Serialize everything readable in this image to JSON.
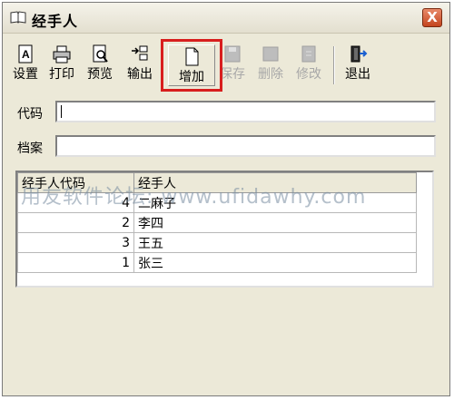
{
  "window": {
    "title": "经手人",
    "close_label": "X"
  },
  "toolbar": {
    "buttons": [
      {
        "label": "设置",
        "icon": "page-setup-icon",
        "enabled": true
      },
      {
        "label": "打印",
        "icon": "printer-icon",
        "enabled": true
      },
      {
        "label": "预览",
        "icon": "preview-icon",
        "enabled": true
      },
      {
        "label": "输出",
        "icon": "export-icon",
        "enabled": true
      },
      {
        "label": "增加",
        "icon": "new-document-icon",
        "enabled": true
      },
      {
        "label": "保存",
        "icon": "save-icon",
        "enabled": false
      },
      {
        "label": "删除",
        "icon": "delete-icon",
        "enabled": false
      },
      {
        "label": "修改",
        "icon": "edit-icon",
        "enabled": false
      },
      {
        "label": "退出",
        "icon": "exit-icon",
        "enabled": true
      }
    ],
    "highlight_color": "#d81e1e"
  },
  "form": {
    "code_label": "代码",
    "code_value": "",
    "archive_label": "档案",
    "archive_value": ""
  },
  "grid": {
    "headers": [
      "经手人代码",
      "经手人"
    ],
    "rows": [
      {
        "code": "4",
        "name": "二麻子"
      },
      {
        "code": "2",
        "name": "李四"
      },
      {
        "code": "3",
        "name": "王五"
      },
      {
        "code": "1",
        "name": "张三"
      }
    ]
  },
  "watermark": "用友软件论坛: www.ufidawhy.com"
}
